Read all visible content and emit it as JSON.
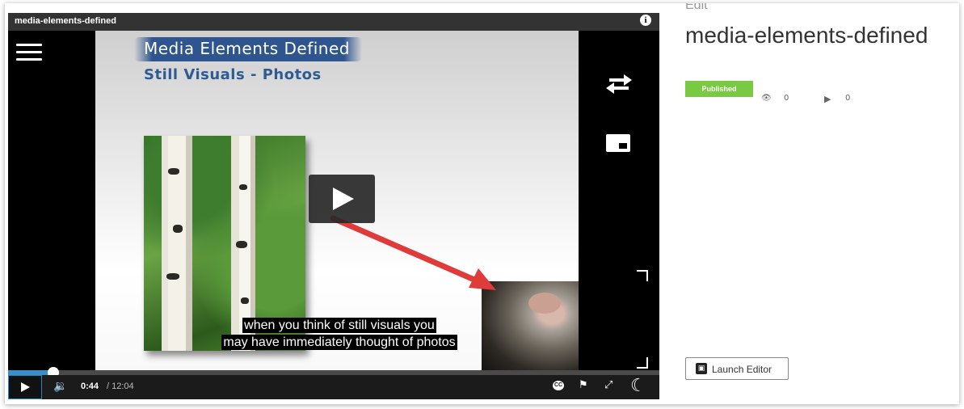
{
  "player": {
    "title": "media-elements-defined",
    "info_icon": "i",
    "slide": {
      "title": "Media Elements Defined",
      "subtitle": "Still Visuals - Photos"
    },
    "captions": [
      "when you think of still visuals you",
      "may have immediately thought of photos"
    ],
    "controls": {
      "current_time": "0:44",
      "total_time": "/ 12:04",
      "cc_label": "CC",
      "volume_icon": "🔉",
      "flag_icon": "⚑",
      "expand_icon": "⤢",
      "moon_icon": "☾"
    },
    "progress": {
      "value": 0.07
    },
    "icons": [
      "menu-icon",
      "info-icon",
      "swap-icon",
      "pip-icon",
      "play-icon",
      "volume-icon",
      "cc-icon",
      "flag-icon",
      "expand-icon",
      "moon-icon"
    ]
  },
  "panel": {
    "edit_label": "Edit",
    "title": "media-elements-defined",
    "status_badge": "Published",
    "eye_icon": "👁",
    "views": "0",
    "play_icon": "▶",
    "plays": "0",
    "launch_button": "Launch Editor",
    "launch_icon": "▣"
  },
  "colors": {
    "accent_blue": "#3a8fc8",
    "badge_green": "#7ac943",
    "slide_title_blue": "#2e5590",
    "arrow_red": "#e03b3b"
  }
}
